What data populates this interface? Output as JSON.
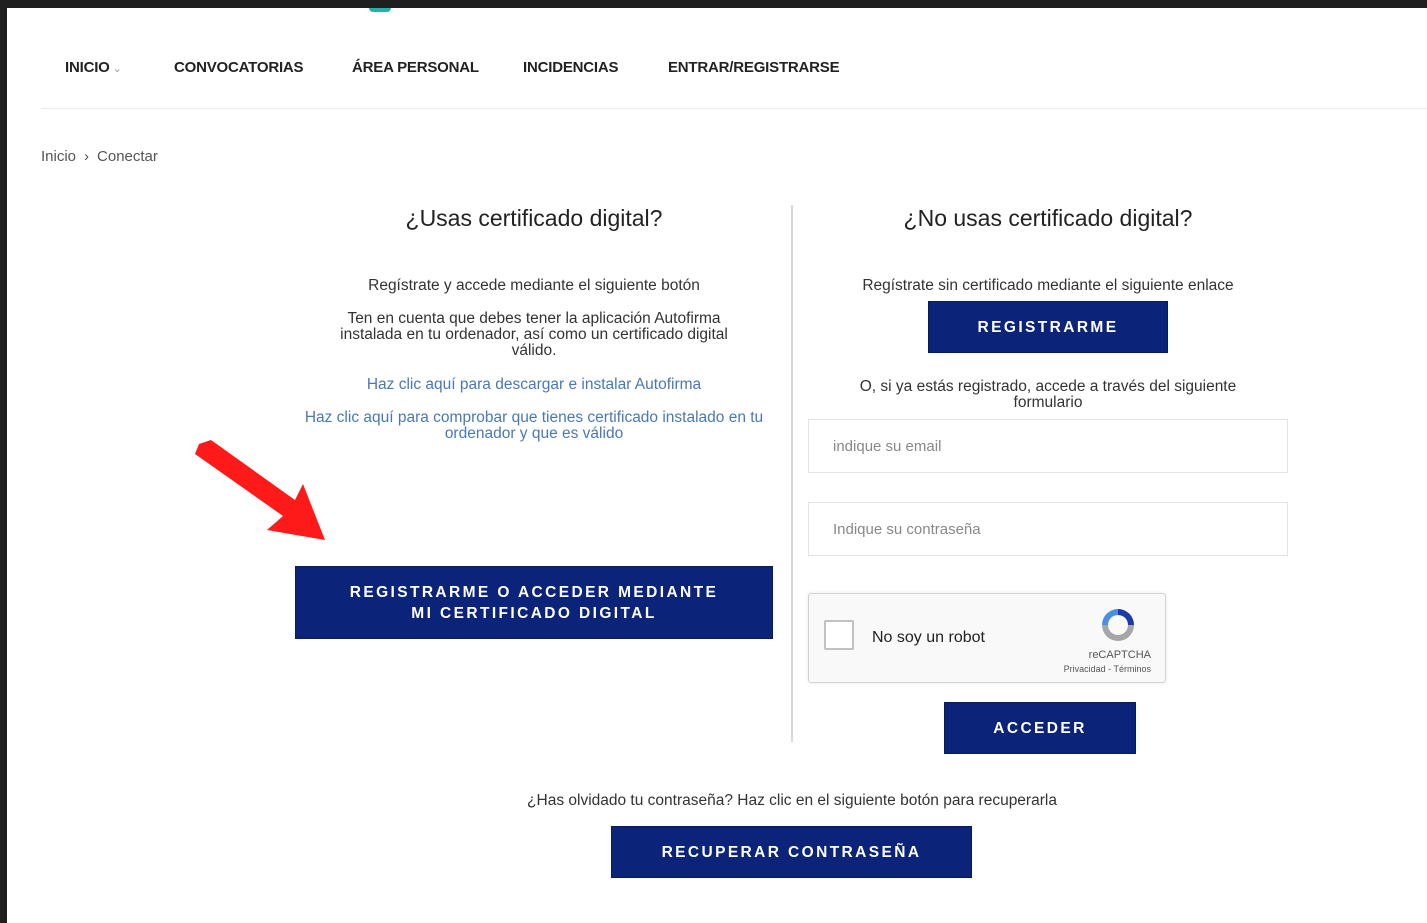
{
  "nav": {
    "items": [
      {
        "label": "INICIO",
        "has_dropdown": true
      },
      {
        "label": "CONVOCATORIAS"
      },
      {
        "label": "ÁREA PERSONAL"
      },
      {
        "label": "INCIDENCIAS"
      },
      {
        "label": "ENTRAR/REGISTRARSE"
      }
    ],
    "dropdown_icon": "chevron-down-icon"
  },
  "breadcrumb": {
    "home": "Inicio",
    "separator": "›",
    "current": "Conectar"
  },
  "left": {
    "title": "¿Usas certificado digital?",
    "intro": "Regístrate y accede mediante el siguiente botón",
    "note": "Ten en cuenta que debes tener la aplicación Autofirma instalada en tu ordenador, así como un certificado digital válido.",
    "link_autofirma": "Haz clic aquí para descargar e instalar Autofirma",
    "link_check_cert": "Haz clic aquí para comprobar que tienes certificado instalado en tu ordenador y que es válido",
    "cert_button": "REGISTRARME O ACCEDER MEDIANTE MI CERTIFICADO DIGITAL"
  },
  "right": {
    "title": "¿No usas certificado digital?",
    "intro": "Regístrate sin certificado mediante el siguiente enlace",
    "register_button": "REGISTRARME",
    "login_intro": "O, si ya estás registrado, accede a través del siguiente formulario",
    "email_placeholder": "indique su email",
    "email_value": "",
    "password_placeholder": "Indique su contraseña",
    "password_value": "",
    "captcha": {
      "label": "No soy un robot",
      "brand": "reCAPTCHA",
      "terms": "Privacidad - Términos",
      "checked": false
    },
    "login_button": "ACCEDER"
  },
  "recover": {
    "text": "¿Has olvidado tu contraseña? Haz clic en el siguiente botón para recuperarla",
    "button": "RECUPERAR CONTRASEÑA"
  },
  "colors": {
    "primary_button": "#0b2378",
    "link": "#4a78b5",
    "annotation_arrow": "#ff1a1a",
    "accent": "#1fb5ad"
  },
  "annotation": {
    "icon": "red-arrow-icon"
  }
}
